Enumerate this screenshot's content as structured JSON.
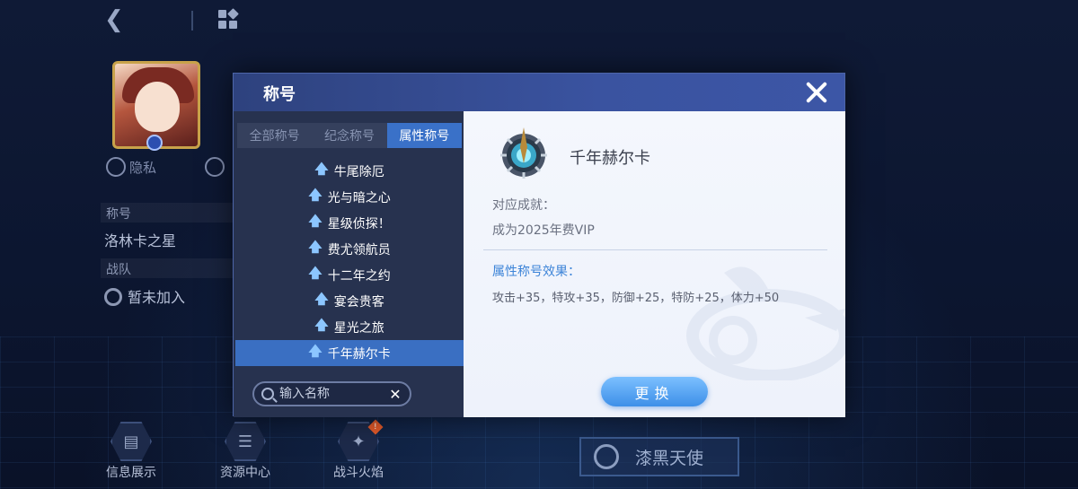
{
  "background": {
    "sidebar": {
      "privacy_label": "隐私",
      "title_label": "称号",
      "title_value": "洛林卡之星",
      "team_label": "战队",
      "team_value": "暂未加入"
    },
    "bottom_nav": [
      {
        "label": "信息展示",
        "icon": "id-card-icon"
      },
      {
        "label": "资源中心",
        "icon": "layers-icon"
      },
      {
        "label": "战斗火焰",
        "icon": "flame-icon"
      }
    ],
    "alert_mark": "!",
    "team_button_label": "漆黑天使"
  },
  "dialog": {
    "title": "称号",
    "tabs": [
      {
        "label": "全部称号",
        "active": false
      },
      {
        "label": "纪念称号",
        "active": false
      },
      {
        "label": "属性称号",
        "active": true
      }
    ],
    "titles": [
      {
        "label": "牛尾除厄",
        "selected": false
      },
      {
        "label": "光与暗之心",
        "selected": false
      },
      {
        "label": "星级侦探！",
        "selected": false
      },
      {
        "label": "费尤领航员",
        "selected": false
      },
      {
        "label": "十二年之约",
        "selected": false
      },
      {
        "label": "宴会贵客",
        "selected": false
      },
      {
        "label": "星光之旅",
        "selected": false
      },
      {
        "label": "千年赫尔卡",
        "selected": true
      }
    ],
    "search": {
      "placeholder": "输入名称",
      "value": ""
    },
    "detail": {
      "name": "千年赫尔卡",
      "condition_label": "对应成就：",
      "condition_value": "成为2025年费VIP",
      "effect_label": "属性称号效果：",
      "effect_value": "攻击+35，特攻+35，防御+25，特防+25，体力+50"
    },
    "change_button_label": "更换"
  },
  "colors": {
    "accent": "#3a71c8",
    "header": "#3a53a0",
    "effect_text": "#3d84d8"
  }
}
